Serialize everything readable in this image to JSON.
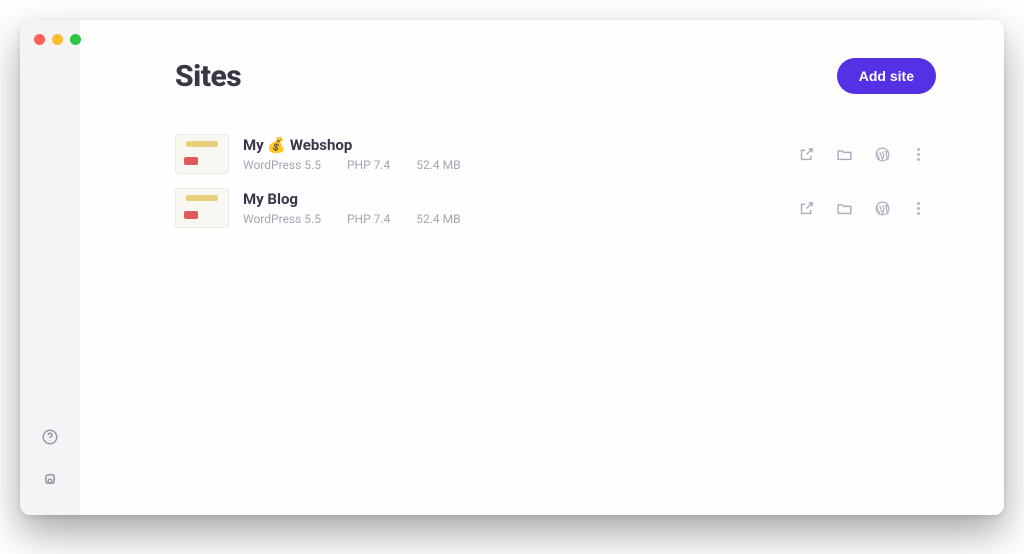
{
  "header": {
    "title": "Sites",
    "add_button": "Add site"
  },
  "sites": [
    {
      "name": "My 💰 Webshop",
      "wordpress": "WordPress 5.5",
      "php": "PHP 7.4",
      "size": "52.4 MB"
    },
    {
      "name": "My Blog",
      "wordpress": "WordPress 5.5",
      "php": "PHP 7.4",
      "size": "52.4 MB"
    }
  ]
}
